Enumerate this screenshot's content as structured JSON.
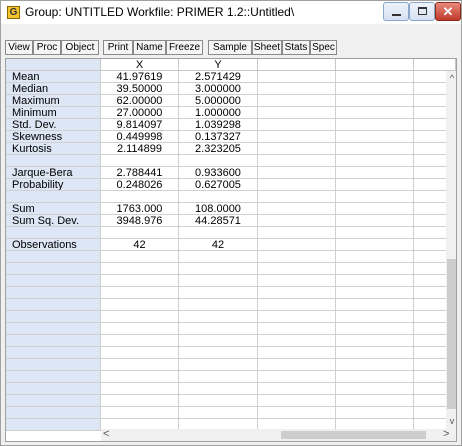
{
  "window": {
    "title": "Group: UNTITLED   Workfile: PRIMER 1.2::Untitled\\",
    "icon_letter": "G",
    "close_glyph": "✕"
  },
  "toolbar": [
    "View",
    "Proc",
    "Object",
    "Print",
    "Name",
    "Freeze",
    "Sample",
    "Sheet",
    "Stats",
    "Spec"
  ],
  "columns": [
    "X",
    "Y"
  ],
  "rows": [
    {
      "label": "Mean",
      "x": "41.97619",
      "y": "2.571429"
    },
    {
      "label": "Median",
      "x": "39.50000",
      "y": "3.000000"
    },
    {
      "label": "Maximum",
      "x": "62.00000",
      "y": "5.000000"
    },
    {
      "label": "Minimum",
      "x": "27.00000",
      "y": "1.000000"
    },
    {
      "label": "Std. Dev.",
      "x": "9.814097",
      "y": "1.039298"
    },
    {
      "label": "Skewness",
      "x": "0.449998",
      "y": "0.137327"
    },
    {
      "label": "Kurtosis",
      "x": "2.114899",
      "y": "2.323205"
    },
    {
      "label": "",
      "x": "",
      "y": ""
    },
    {
      "label": "Jarque-Bera",
      "x": "2.788441",
      "y": "0.933600"
    },
    {
      "label": "Probability",
      "x": "0.248026",
      "y": "0.627005"
    },
    {
      "label": "",
      "x": "",
      "y": ""
    },
    {
      "label": "Sum",
      "x": "1763.000",
      "y": "108.0000"
    },
    {
      "label": "Sum Sq. Dev.",
      "x": "3948.976",
      "y": "44.28571"
    },
    {
      "label": "",
      "x": "",
      "y": ""
    },
    {
      "label": "Observations",
      "x": "42",
      "y": "42"
    }
  ],
  "scroll": {
    "left": "<",
    "right": ">",
    "up": "^",
    "down": "v"
  }
}
